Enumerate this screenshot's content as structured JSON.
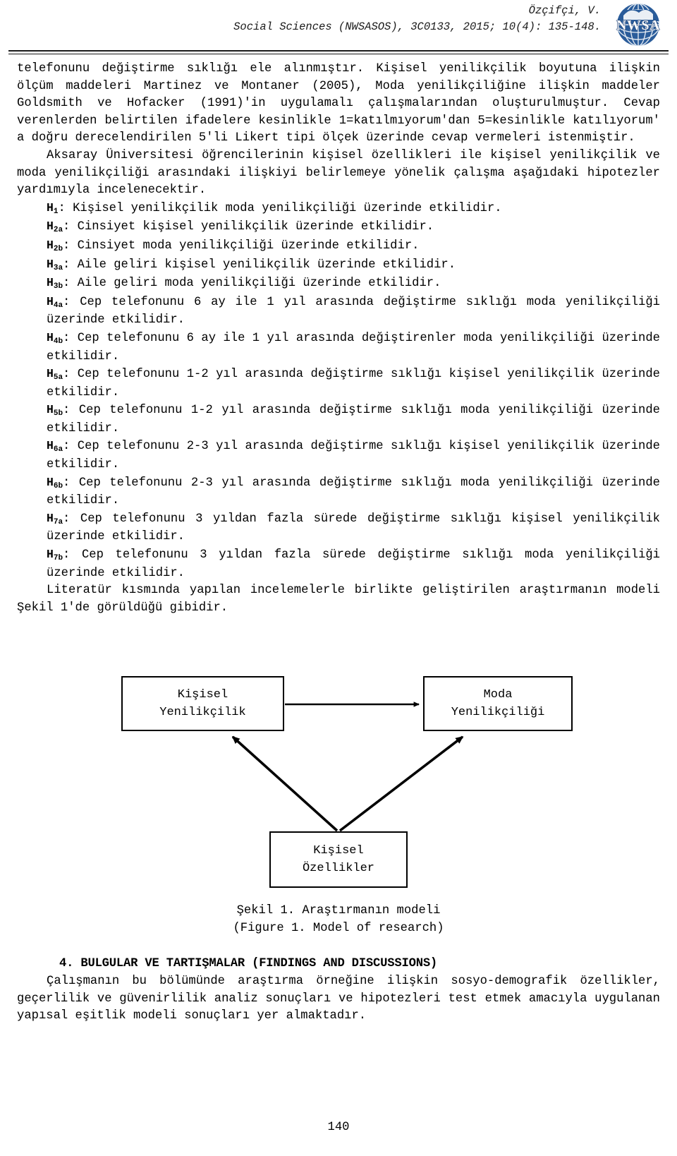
{
  "header": {
    "author": "Özçifçi, V.",
    "citation": "Social Sciences (NWSASOS), 3C0133, 2015; 10(4): 135-148.",
    "logo_alt": "NWSA",
    "logo_text": "NWSA"
  },
  "body": {
    "para1": "telefonunu değiştirme sıklığı ele alınmıştır. Kişisel yenilikçilik boyutuna ilişkin ölçüm maddeleri Martinez ve Montaner (2005), Moda yenilikçiliğine ilişkin maddeler Goldsmith ve Hofacker (1991)'in uygulamalı çalışmalarından oluşturulmuştur. Cevap verenlerden belirtilen ifadelere kesinlikle 1=katılmıyorum'dan 5=kesinlikle katılıyorum' a doğru derecelendirilen 5'li Likert tipi ölçek üzerinde cevap vermeleri istenmiştir.",
    "para2": "Aksaray Üniversitesi öğrencilerinin kişisel özellikleri ile kişisel yenilikçilik ve moda yenilikçiliği arasındaki ilişkiyi belirlemeye yönelik çalışma aşağıdaki hipotezler yardımıyla incelenecektir.",
    "para3": "Literatür kısmında yapılan incelemelerle birlikte geliştirilen araştırmanın modeli Şekil 1'de görüldüğü gibidir."
  },
  "hypotheses": [
    {
      "label": "H",
      "num": "1",
      "text": ": Kişisel yenilikçilik moda yenilikçiliği üzerinde etkilidir."
    },
    {
      "label": "H",
      "num": "2a",
      "text": ": Cinsiyet kişisel yenilikçilik üzerinde etkilidir."
    },
    {
      "label": "H",
      "num": "2b",
      "text": ": Cinsiyet moda yenilikçiliği üzerinde etkilidir."
    },
    {
      "label": "H",
      "num": "3a",
      "text": ": Aile geliri kişisel yenilikçilik üzerinde etkilidir."
    },
    {
      "label": "H",
      "num": "3b",
      "text": ": Aile geliri moda yenilikçiliği üzerinde etkilidir."
    },
    {
      "label": "H",
      "num": "4a",
      "text": ": Cep telefonunu 6 ay ile 1 yıl arasında değiştirme sıklığı moda yenilikçiliği üzerinde etkilidir."
    },
    {
      "label": "H",
      "num": "4b",
      "text": ": Cep telefonunu 6 ay ile 1 yıl arasında değiştirenler moda yenilikçiliği üzerinde etkilidir."
    },
    {
      "label": "H",
      "num": "5a",
      "text": ": Cep telefonunu 1-2 yıl arasında değiştirme sıklığı kişisel yenilikçilik üzerinde etkilidir."
    },
    {
      "label": "H",
      "num": "5b",
      "text": ": Cep telefonunu 1-2 yıl arasında değiştirme sıklığı moda yenilikçiliği üzerinde etkilidir."
    },
    {
      "label": "H",
      "num": "6a",
      "text": ": Cep telefonunu 2-3 yıl arasında değiştirme sıklığı kişisel yenilikçilik üzerinde etkilidir."
    },
    {
      "label": "H",
      "num": "6b",
      "text": ": Cep telefonunu 2-3 yıl arasında değiştirme sıklığı moda yenilikçiliği üzerinde etkilidir."
    },
    {
      "label": "H",
      "num": "7a",
      "text": ": Cep telefonunu 3 yıldan fazla sürede değiştirme sıklığı kişisel yenilikçilik üzerinde etkilidir."
    },
    {
      "label": "H",
      "num": "7b",
      "text": ": Cep telefonunu 3 yıldan fazla sürede değiştirme sıklığı moda yenilikçiliği üzerinde etkilidir."
    }
  ],
  "figure": {
    "box_personal_line1": "Kişisel",
    "box_personal_line2": "Yenilikçilik",
    "box_fashion_line1": "Moda",
    "box_fashion_line2": "Yenilikçiliği",
    "box_traits_line1": "Kişisel",
    "box_traits_line2": "Özellikler",
    "caption_tr": "Şekil 1. Araştırmanın modeli",
    "caption_en": "(Figure 1. Model of research)"
  },
  "section": {
    "heading": "4. BULGULAR VE TARTIŞMALAR (FINDINGS AND DISCUSSIONS)",
    "paragraph": "Çalışmanın bu bölümünde araştırma örneğine ilişkin sosyo-demografik özellikler, geçerlilik ve güvenirlilik analiz sonuçları ve hipotezleri test etmek amacıyla uygulanan yapısal eşitlik modeli sonuçları yer almaktadır."
  },
  "footer": {
    "page_number": "140"
  },
  "colors": {
    "logo_blue": "#1f4e8c",
    "logo_light": "#6f9ed6",
    "text": "#000000"
  }
}
